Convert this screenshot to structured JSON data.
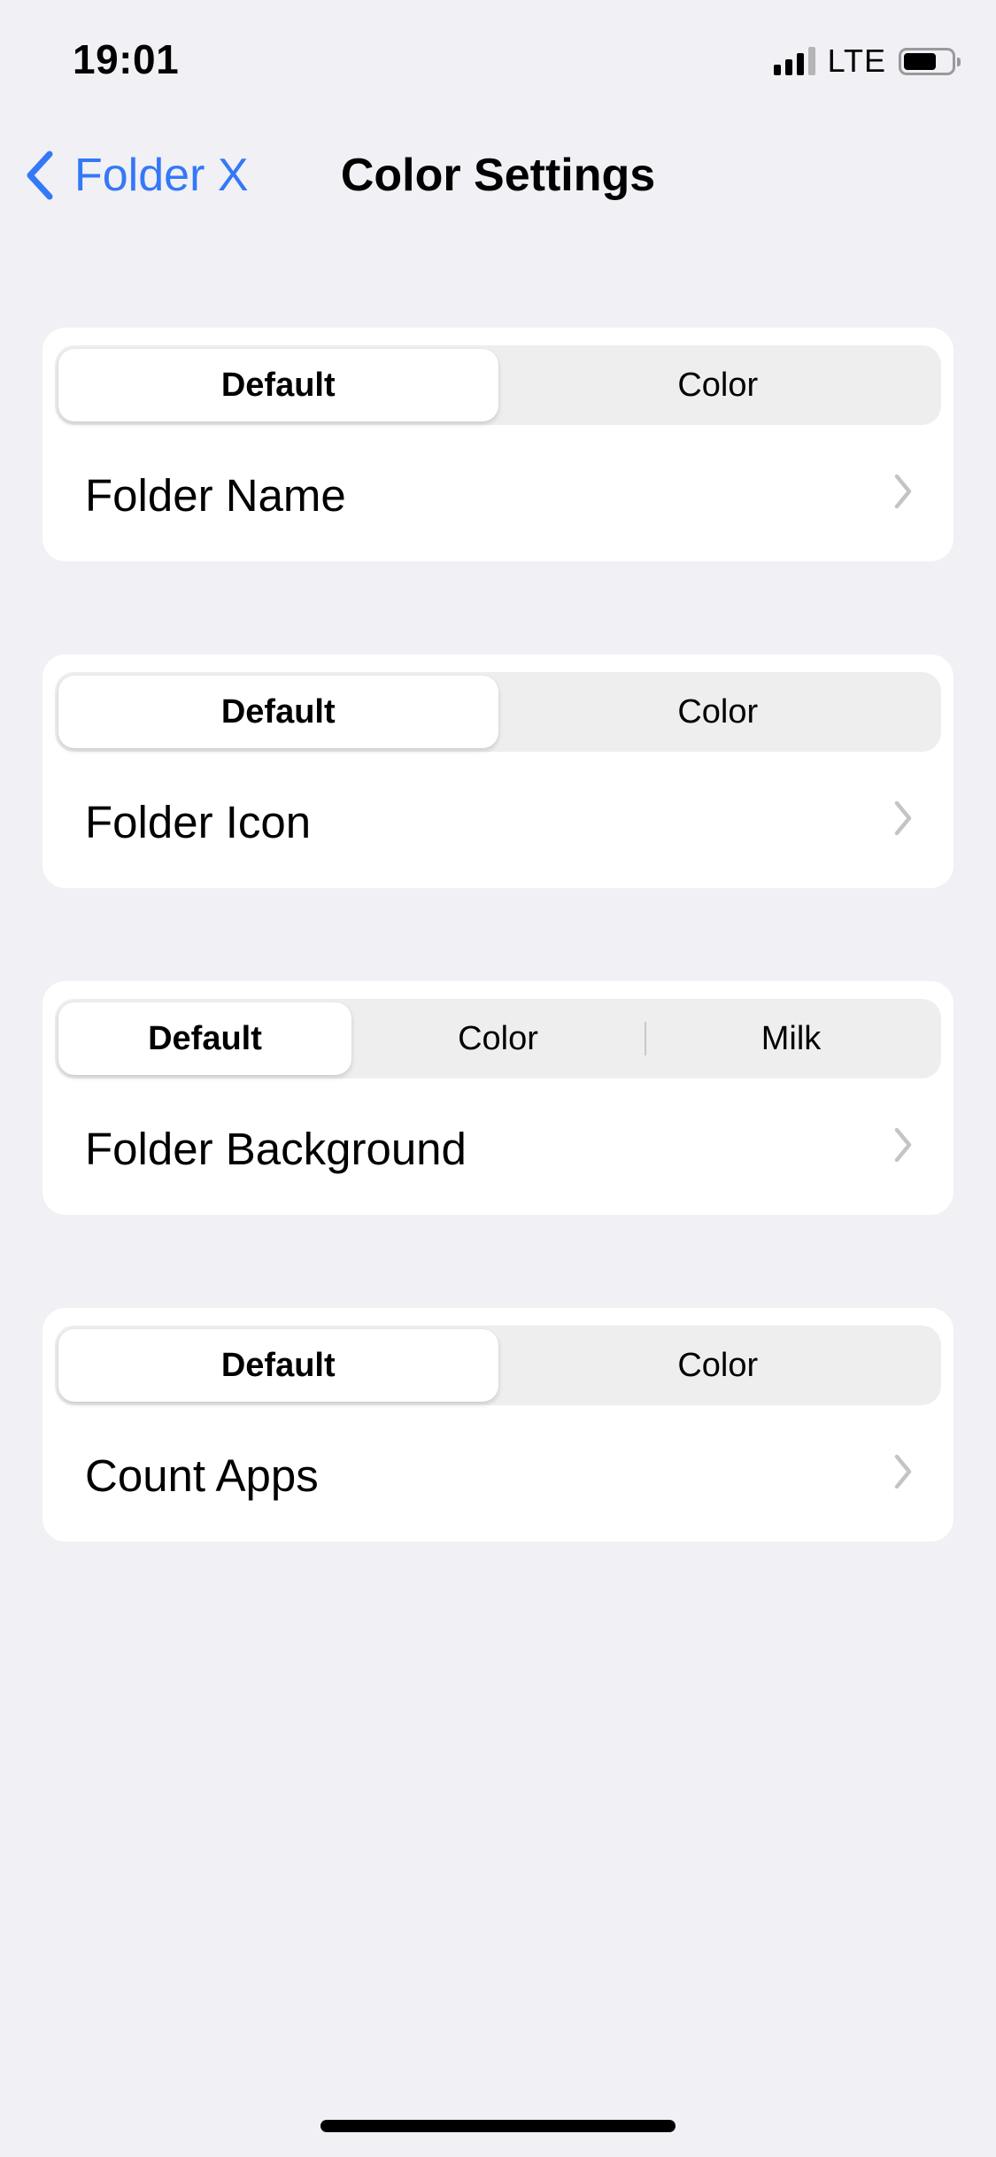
{
  "status_bar": {
    "time": "19:01",
    "network": "LTE",
    "signal_bars_active": 3,
    "signal_bars_total": 4
  },
  "nav": {
    "back_label": "Folder X",
    "title": "Color Settings",
    "accent_color": "#3478f6"
  },
  "sections": [
    {
      "segments": [
        "Default",
        "Color"
      ],
      "selected": 0,
      "row_label": "Folder Name"
    },
    {
      "segments": [
        "Default",
        "Color"
      ],
      "selected": 0,
      "row_label": "Folder Icon"
    },
    {
      "segments": [
        "Default",
        "Color",
        "Milk"
      ],
      "selected": 0,
      "row_label": "Folder Background"
    },
    {
      "segments": [
        "Default",
        "Color"
      ],
      "selected": 0,
      "row_label": "Count Apps"
    }
  ],
  "colors": {
    "background": "#f0f0f5",
    "card": "#ffffff",
    "segment_track": "#eeeeef",
    "chevron": "#c4c4c7"
  }
}
